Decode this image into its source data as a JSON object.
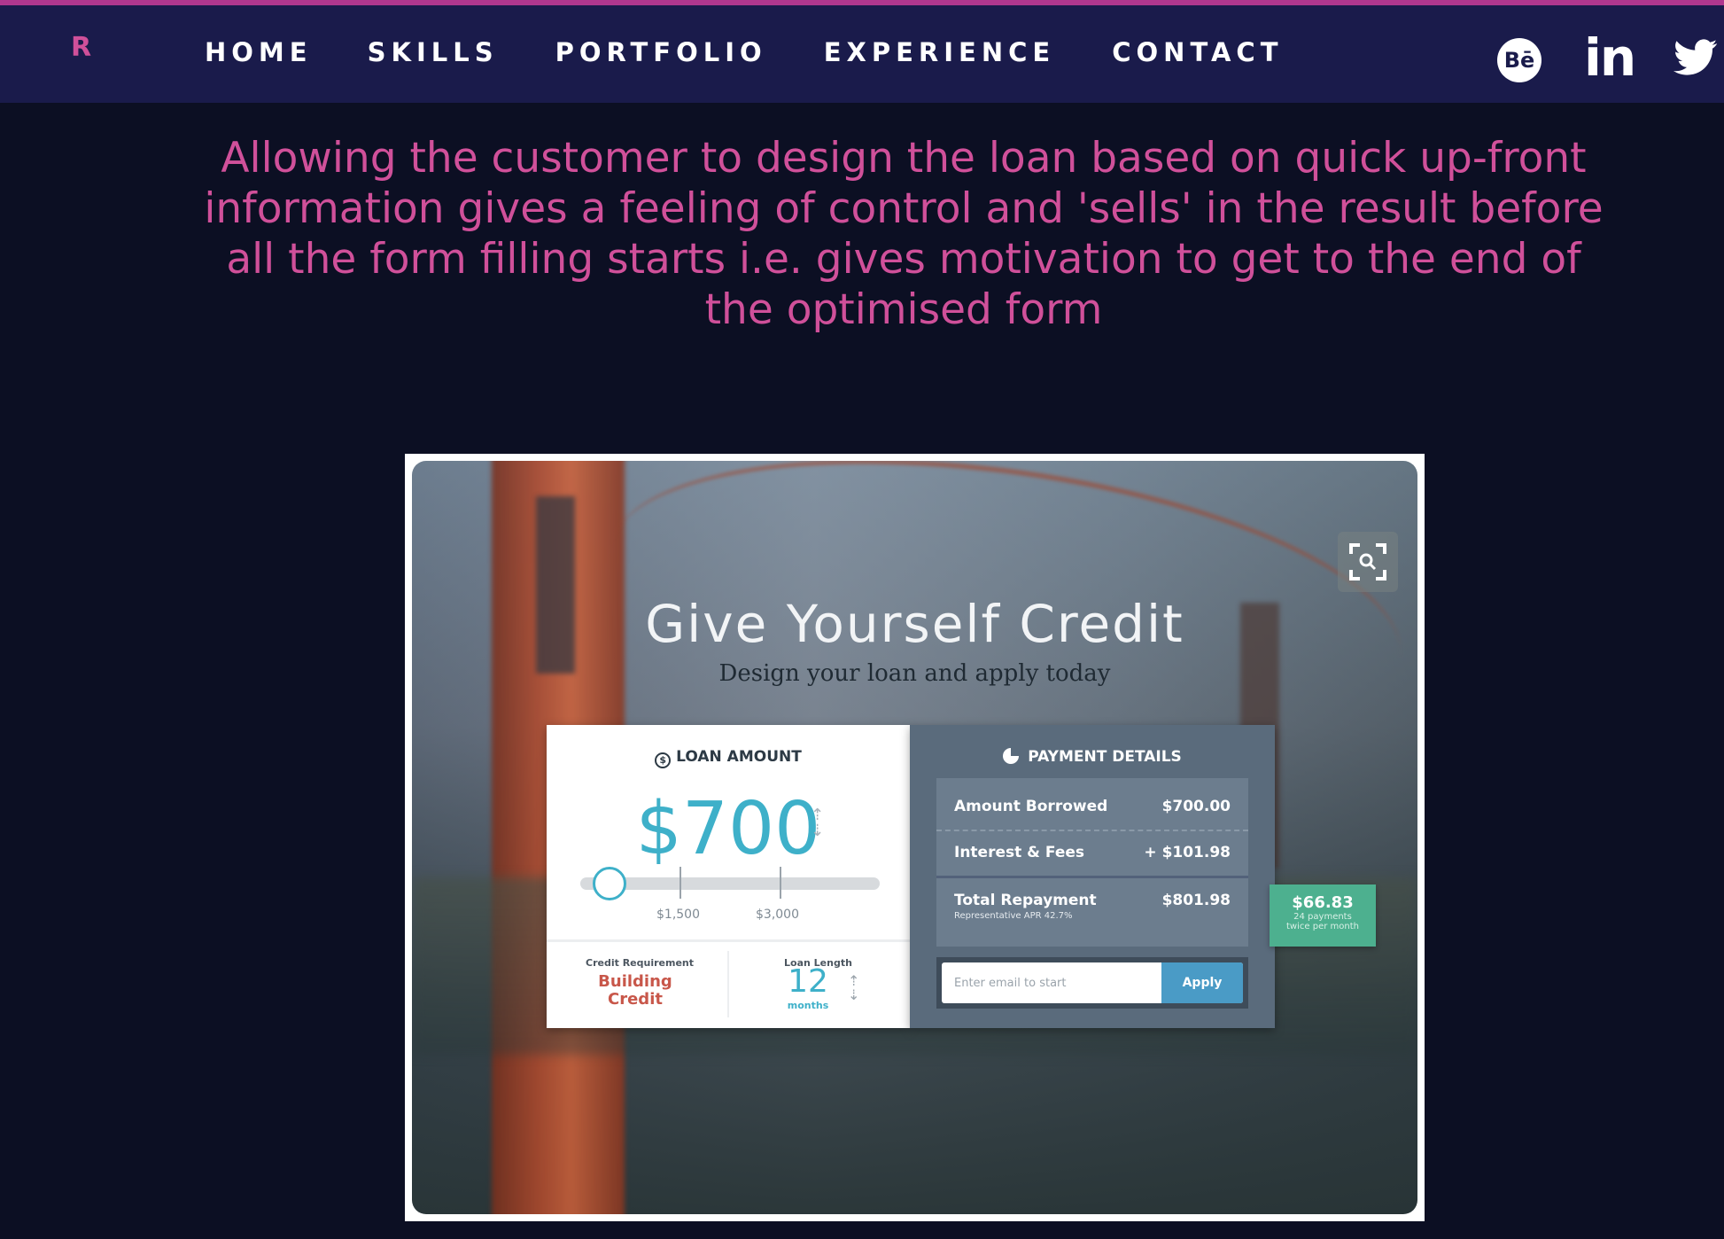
{
  "header": {
    "logo": "R",
    "nav": [
      "HOME",
      "SKILLS",
      "PORTFOLIO",
      "EXPERIENCE",
      "CONTACT"
    ],
    "social": {
      "behance_label": "Bē",
      "linkedin_label": "in",
      "twitter_icon": "twitter-bird-icon"
    }
  },
  "colors": {
    "accent": "#d0509a",
    "topbar": "#1a1b4b",
    "background": "#0c0f23",
    "top_border": "#b0378e"
  },
  "caption": "Allowing the customer to design the loan based on quick up-front information gives a feeling of control and 'sells' in the result before all the form filling starts i.e. gives motivation to get to the end of the optimised form",
  "screenshot": {
    "zoom_icon": "zoom-search-icon",
    "title": "Give Yourself Credit",
    "subtitle": "Design your loan and apply today",
    "loan": {
      "header": "LOAN AMOUNT",
      "coin_symbol": "$",
      "amount": "$700",
      "slider_fraction": 0.08,
      "tick1": "$1,500",
      "tick2": "$3,000",
      "credit_label": "Credit Requirement",
      "credit_value": "Building Credit",
      "length_label": "Loan Length",
      "length_value": "12",
      "length_unit": "months"
    },
    "payment": {
      "header": "PAYMENT DETAILS",
      "rows": [
        {
          "label": "Amount Borrowed",
          "value": "$700.00"
        },
        {
          "label": "Interest & Fees",
          "value": "+ $101.98"
        },
        {
          "label": "Total Repayment",
          "value": "$801.98"
        }
      ],
      "apr": "Representative APR 42.7%",
      "email_placeholder": "Enter email to start",
      "apply": "Apply",
      "installment": "$66.83",
      "installment_note1": "24 payments",
      "installment_note2": "twice per month"
    }
  }
}
